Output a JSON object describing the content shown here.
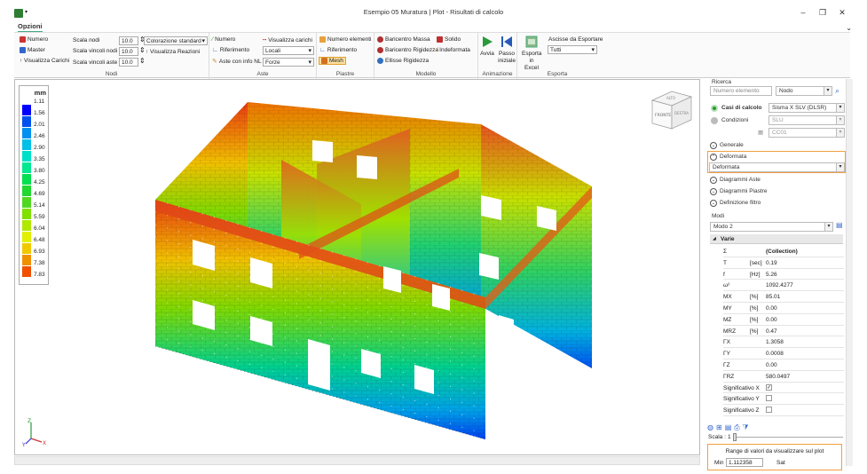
{
  "window": {
    "title": "Esempio 05 Muratura | Plot - Risultati di calcolo",
    "tab": "Opzioni",
    "minimize": "–",
    "maximize": "❐",
    "close": "✕"
  },
  "ribbon": {
    "nodi": {
      "label": "Nodi",
      "numero": "Numero",
      "master": "Master",
      "visualizza_carichi": "Visualizza Carichi",
      "scala_nodi": "Scala nodi",
      "scala_vincoli_nodi": "Scala vincoli nodi",
      "scala_vincoli_aste": "Scala vincoli aste",
      "scala_nodi_val": "10.0",
      "scala_vincoli_nodi_val": "10.0",
      "scala_vincoli_aste_val": "10.0",
      "colorazione": "Colorazione standard",
      "visualizza_reazioni": "Visualizza Reazioni"
    },
    "aste": {
      "label": "Aste",
      "numero": "Numero",
      "riferimento": "Riferimento",
      "aste_info_nl": "Aste con info NL",
      "visualizza_carichi": "Visualizza carichi",
      "locali": "Locali",
      "forze": "Forze"
    },
    "piastre": {
      "label": "Piastre",
      "numero_elementi": "Numero elementi",
      "riferimento": "Riferimento",
      "mesh": "Mesh"
    },
    "modello": {
      "label": "Modello",
      "baricentro_massa": "Baricentro Massa",
      "baricentro_rigidezza": "Baricentro Rigidezza",
      "ellisse_rigidezza": "Ellisse Rigidezza",
      "solido": "Solido",
      "indeformata": "Indeformata"
    },
    "animazione": {
      "label": "Animazione",
      "avvia": "Avvia",
      "passo": "Passo",
      "iniziale": "iniziale"
    },
    "esporta": {
      "label": "Esporta",
      "esporta": "Esporta",
      "in_excel": "in Excel",
      "ascisse": "Ascisse da Esportare",
      "tutti": "Tutti"
    }
  },
  "legend": {
    "unit": "mm",
    "values": [
      "1.11",
      "1.56",
      "2.01",
      "2.46",
      "2.90",
      "3.35",
      "3.80",
      "4.25",
      "4.69",
      "5.14",
      "5.59",
      "6.04",
      "6.48",
      "6.93",
      "7.38",
      "7.83"
    ],
    "colors": [
      "#0000ff",
      "#0050f0",
      "#0090f0",
      "#00c0e8",
      "#00e0c8",
      "#00e890",
      "#00e050",
      "#20d830",
      "#50d820",
      "#80e000",
      "#b0e800",
      "#e0f000",
      "#f0c800",
      "#f09000",
      "#f05000",
      "#e83000"
    ]
  },
  "viewcube": {
    "top": "ALTO",
    "front": "FRONTE",
    "right": "DESTRA"
  },
  "axes": {
    "x": "X",
    "y": "Y",
    "z": "Z"
  },
  "panel": {
    "ricerca": "Ricerca",
    "numero_elemento_ph": "Numero elemento",
    "nodo": "Nodo",
    "casi_di_calcolo": "Casi di calcolo",
    "caso_sel": "Sisma X SLV (DLSR)",
    "condizioni": "Condizioni",
    "slu": "SLU",
    "cc01": "CC01",
    "generale": "Generale",
    "deformata": "Deformata",
    "deformata_sel": "Deformata",
    "diagrammi_aste": "Diagrammi Aste",
    "diagrammi_piastre": "Diagrammi Piastre",
    "definizione_filtro": "Definizione filtro",
    "modi": "Modi",
    "modo_sel": "Modo 2",
    "varie": "Varie",
    "rows": [
      {
        "name": "Σ",
        "unit": "",
        "value": "(Collection)"
      },
      {
        "name": "T",
        "unit": "[sec]",
        "value": "0.19"
      },
      {
        "name": "f",
        "unit": "[Hz]",
        "value": "5.26"
      },
      {
        "name": "ω²",
        "unit": "",
        "value": "1092.4277"
      },
      {
        "name": "MX",
        "unit": "[%]",
        "value": "85.01"
      },
      {
        "name": "MY",
        "unit": "[%]",
        "value": "0.00"
      },
      {
        "name": "MZ",
        "unit": "[%]",
        "value": "0.00"
      },
      {
        "name": "MRZ",
        "unit": "[%]",
        "value": "0.47"
      },
      {
        "name": "ΓX",
        "unit": "",
        "value": "1.3058"
      },
      {
        "name": "ΓY",
        "unit": "",
        "value": "0.0008"
      },
      {
        "name": "ΓZ",
        "unit": "",
        "value": "0.00"
      },
      {
        "name": "ΓRZ",
        "unit": "",
        "value": "580.0497"
      },
      {
        "name": "Significativo X",
        "unit": "",
        "value": "✓"
      },
      {
        "name": "Significativo Y",
        "unit": "",
        "value": ""
      },
      {
        "name": "Significativo Z",
        "unit": "",
        "value": ""
      }
    ],
    "scala": "Scala :",
    "scala_val": "1",
    "range_title": "Range di valori da visualizzare sul plot",
    "min_label": "Min",
    "min_val": "1.112358",
    "sat": "Sat"
  }
}
